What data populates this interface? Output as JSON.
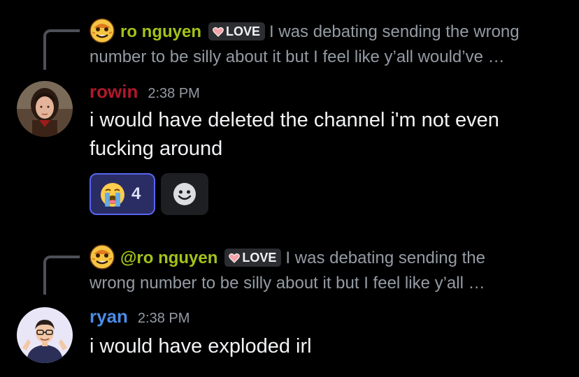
{
  "messages": [
    {
      "reply": {
        "author": "ro nguyen",
        "badge": "LOVE",
        "text": "I was debating sending the wrong number to be silly about it but I feel like y’all would’ve …"
      },
      "username": "rowin",
      "timestamp": "2:38 PM",
      "content_lines": [
        "i would have deleted the channel i'm not even",
        "fucking around"
      ],
      "reactions": [
        {
          "emoji": "loudly-crying-face-icon",
          "count": "4",
          "active": true
        }
      ]
    },
    {
      "reply": {
        "author": "@ro nguyen",
        "badge": "LOVE",
        "text_lines": [
          "I was debating sending the",
          "wrong number to be silly about it but I feel like y’all …"
        ]
      },
      "username": "ryan",
      "timestamp": "2:38 PM",
      "content": "i would have exploded irl"
    }
  ],
  "colors": {
    "background": "#000000",
    "reply_author": "#a3c21a",
    "rowin": "#b0182a",
    "ryan": "#4b8de6",
    "muted": "#949ba4",
    "reaction_active_bg": "#2a2d63",
    "reaction_active_border": "#5865f2"
  },
  "icons": {
    "add_reaction": "smiley-add-reaction-icon",
    "badge_heart": "heart-icon"
  }
}
